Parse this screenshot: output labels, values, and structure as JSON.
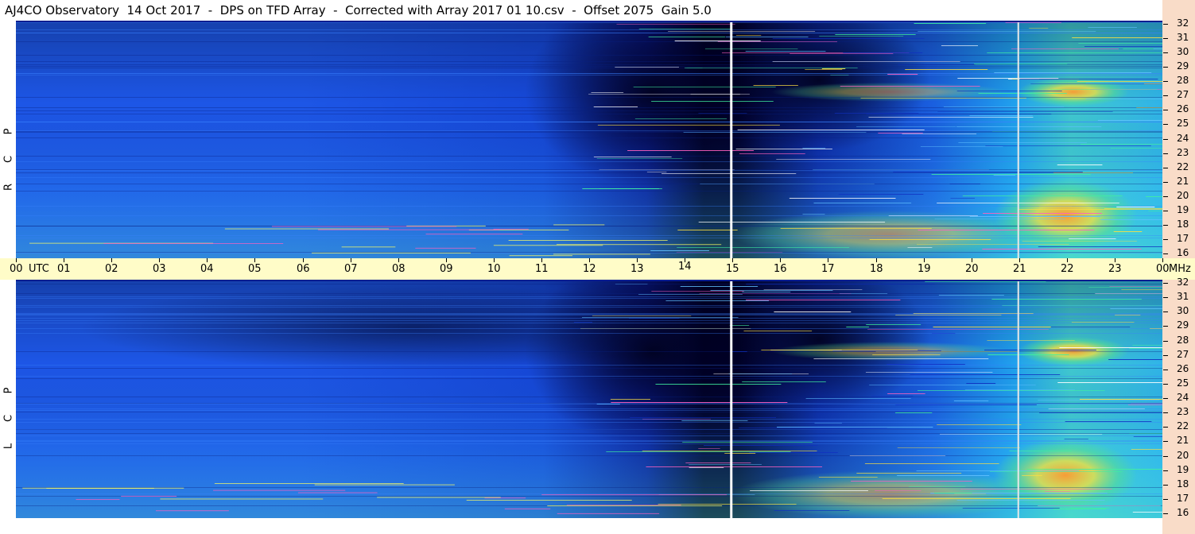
{
  "title": "AJ4CO Observatory  14 Oct 2017  -  DPS on TFD Array  -  Corrected with Array 2017 01 10.csv  -  Offset 2075  Gain 5.0",
  "panels": [
    {
      "id": "rcp",
      "label_chars": [
        "R",
        "C",
        "P"
      ]
    },
    {
      "id": "lcp",
      "label_chars": [
        "L",
        "C",
        "P"
      ]
    }
  ],
  "time_axis": {
    "unit_label": "UTC",
    "end_unit": "MHz",
    "labels": [
      "00",
      "01",
      "02",
      "03",
      "04",
      "05",
      "06",
      "07",
      "08",
      "09",
      "10",
      "11",
      "12",
      "13",
      "14",
      "15",
      "16",
      "17",
      "18",
      "19",
      "20",
      "21",
      "22",
      "23",
      "00"
    ]
  },
  "freq_axis": {
    "labels": [
      "32",
      "31",
      "30",
      "29",
      "28",
      "27",
      "26",
      "25",
      "24",
      "23",
      "22",
      "21",
      "20",
      "19",
      "18",
      "17",
      "16"
    ]
  },
  "colors": {
    "deep": "#000030",
    "dark_blue": "#0a1b9a",
    "blue": "#1d56e6",
    "cyan": "#18a6f0",
    "green": "#58e08a",
    "yellow": "#f0e040",
    "orange": "#ff9a30",
    "magenta": "#ff40c0",
    "axis_bg": "#fffcc8",
    "strip_bg": "#f9dcc8"
  }
}
